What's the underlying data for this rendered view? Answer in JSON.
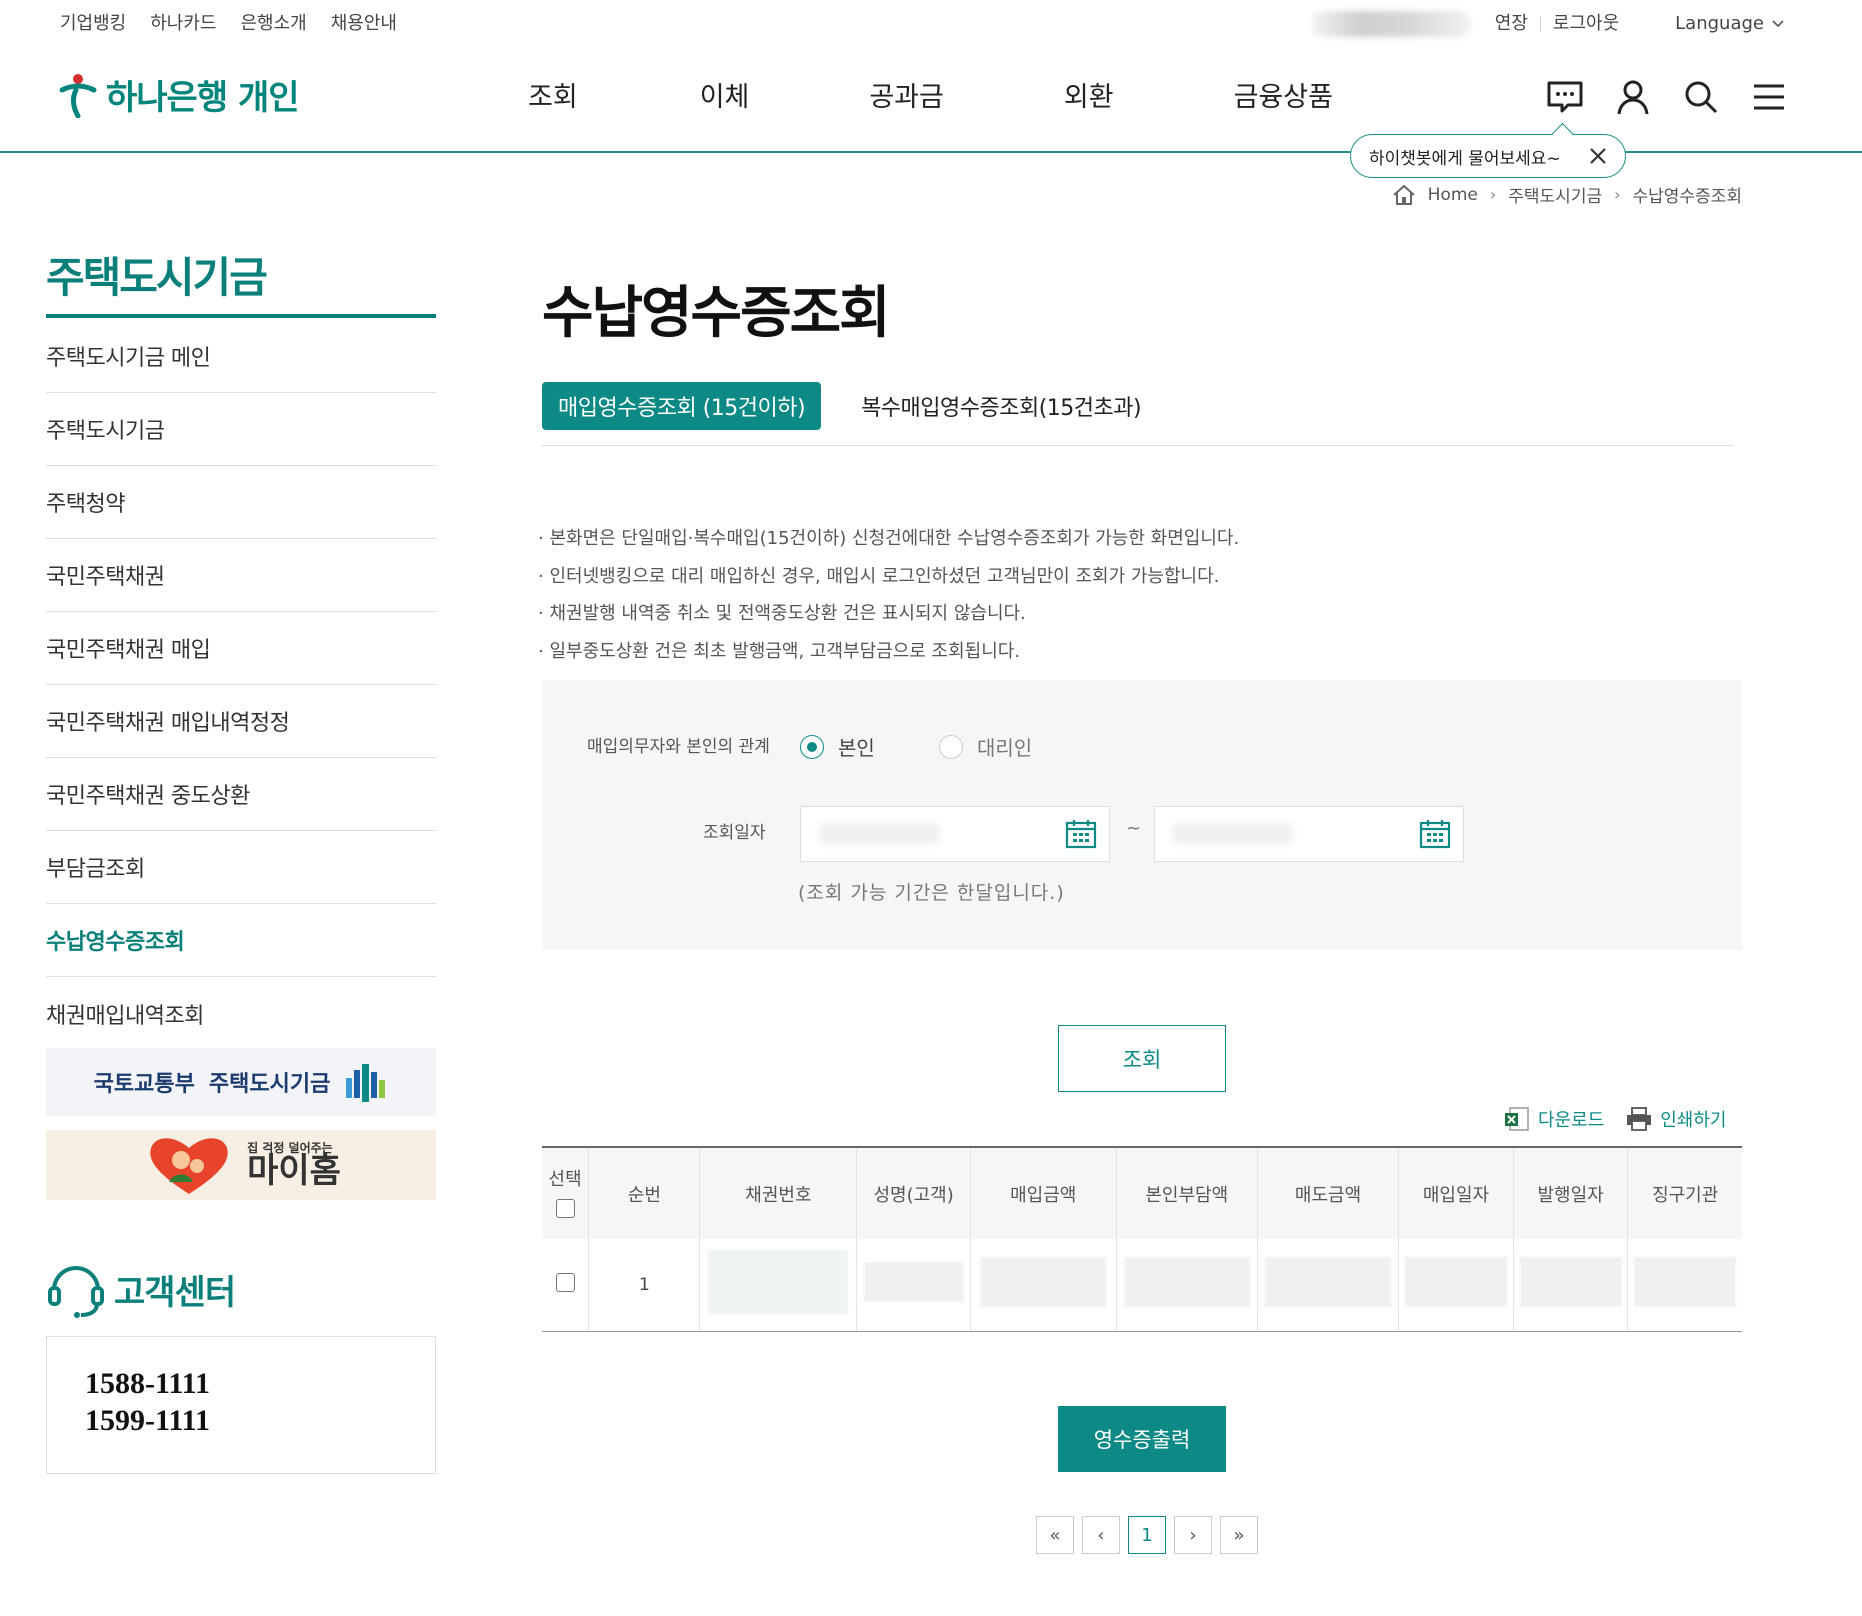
{
  "util": {
    "links": [
      "기업뱅킹",
      "하나카드",
      "은행소개",
      "채용안내"
    ],
    "extend": "연장",
    "logout": "로그아웃",
    "language": "Language"
  },
  "header": {
    "logo_text": "하나은행",
    "logo_sub": "개인",
    "nav": [
      "조회",
      "이체",
      "공과금",
      "외환",
      "금융상품"
    ],
    "icons": [
      "chat-icon",
      "user-icon",
      "search-icon",
      "menu-icon"
    ],
    "chatbot_tip": "하이챗봇에게 물어보세요~"
  },
  "breadcrumb": [
    "Home",
    "주택도시기금",
    "수납영수증조회"
  ],
  "sidebar": {
    "title": "주택도시기금",
    "items": [
      {
        "label": "주택도시기금 메인"
      },
      {
        "label": "주택도시기금"
      },
      {
        "label": "주택청약"
      },
      {
        "label": "국민주택채권"
      },
      {
        "label": "국민주택채권 매입"
      },
      {
        "label": "국민주택채권 매입내역정정"
      },
      {
        "label": "국민주택채권 중도상환"
      },
      {
        "label": "부담금조회"
      },
      {
        "label": "수납영수증조회",
        "active": true
      },
      {
        "label": "채권매입내역조회"
      }
    ],
    "banner1": {
      "left": "국토교통부",
      "right": "주택도시기금"
    },
    "banner2": {
      "small": "집 걱정 덜어주는",
      "big": "마이홈"
    },
    "cs_title": "고객센터",
    "phones": [
      "1588-1111",
      "1599-1111"
    ]
  },
  "main": {
    "title": "수납영수증조회",
    "tabs": [
      {
        "label": "매입영수증조회 (15건이하)",
        "active": true
      },
      {
        "label": "복수매입영수증조회(15건초과)",
        "active": false
      }
    ],
    "notes": [
      "본화면은 단일매입·복수매입(15건이하) 신청건에대한 수납영수증조회가 가능한 화면입니다.",
      "인터넷뱅킹으로 대리 매입하신 경우, 매입시 로그인하셨던 고객님만이 조회가 가능합니다.",
      "채권발행 내역중 취소 및 전액중도상환 건은 표시되지 않습니다.",
      "일부중도상환 건은 최초 발행금액, 고객부담금으로 조회됩니다."
    ],
    "form": {
      "relation_label": "매입의무자와 본인의 관계",
      "options": [
        {
          "label": "본인",
          "selected": true
        },
        {
          "label": "대리인",
          "selected": false
        }
      ],
      "date_label": "조회일자",
      "range_sep": "~",
      "date_hint": "(조회 가능 기간은 한달입니다.)"
    },
    "search_button": "조회",
    "tools": {
      "download": "다운로드",
      "print": "인쇄하기"
    },
    "table": {
      "headers": [
        "선택",
        "순번",
        "채권번호",
        "성명(고객)",
        "매입금액",
        "본인부담액",
        "매도금액",
        "매입일자",
        "발행일자",
        "징구기관"
      ],
      "rows": [
        {
          "seq": "1"
        }
      ]
    },
    "print_button": "영수증출력",
    "paging": {
      "first": "«",
      "prev": "‹",
      "current": "1",
      "next": "›",
      "last": "»"
    }
  },
  "colors": {
    "brand": "#0e8a86",
    "accent_red": "#d32f2f"
  }
}
